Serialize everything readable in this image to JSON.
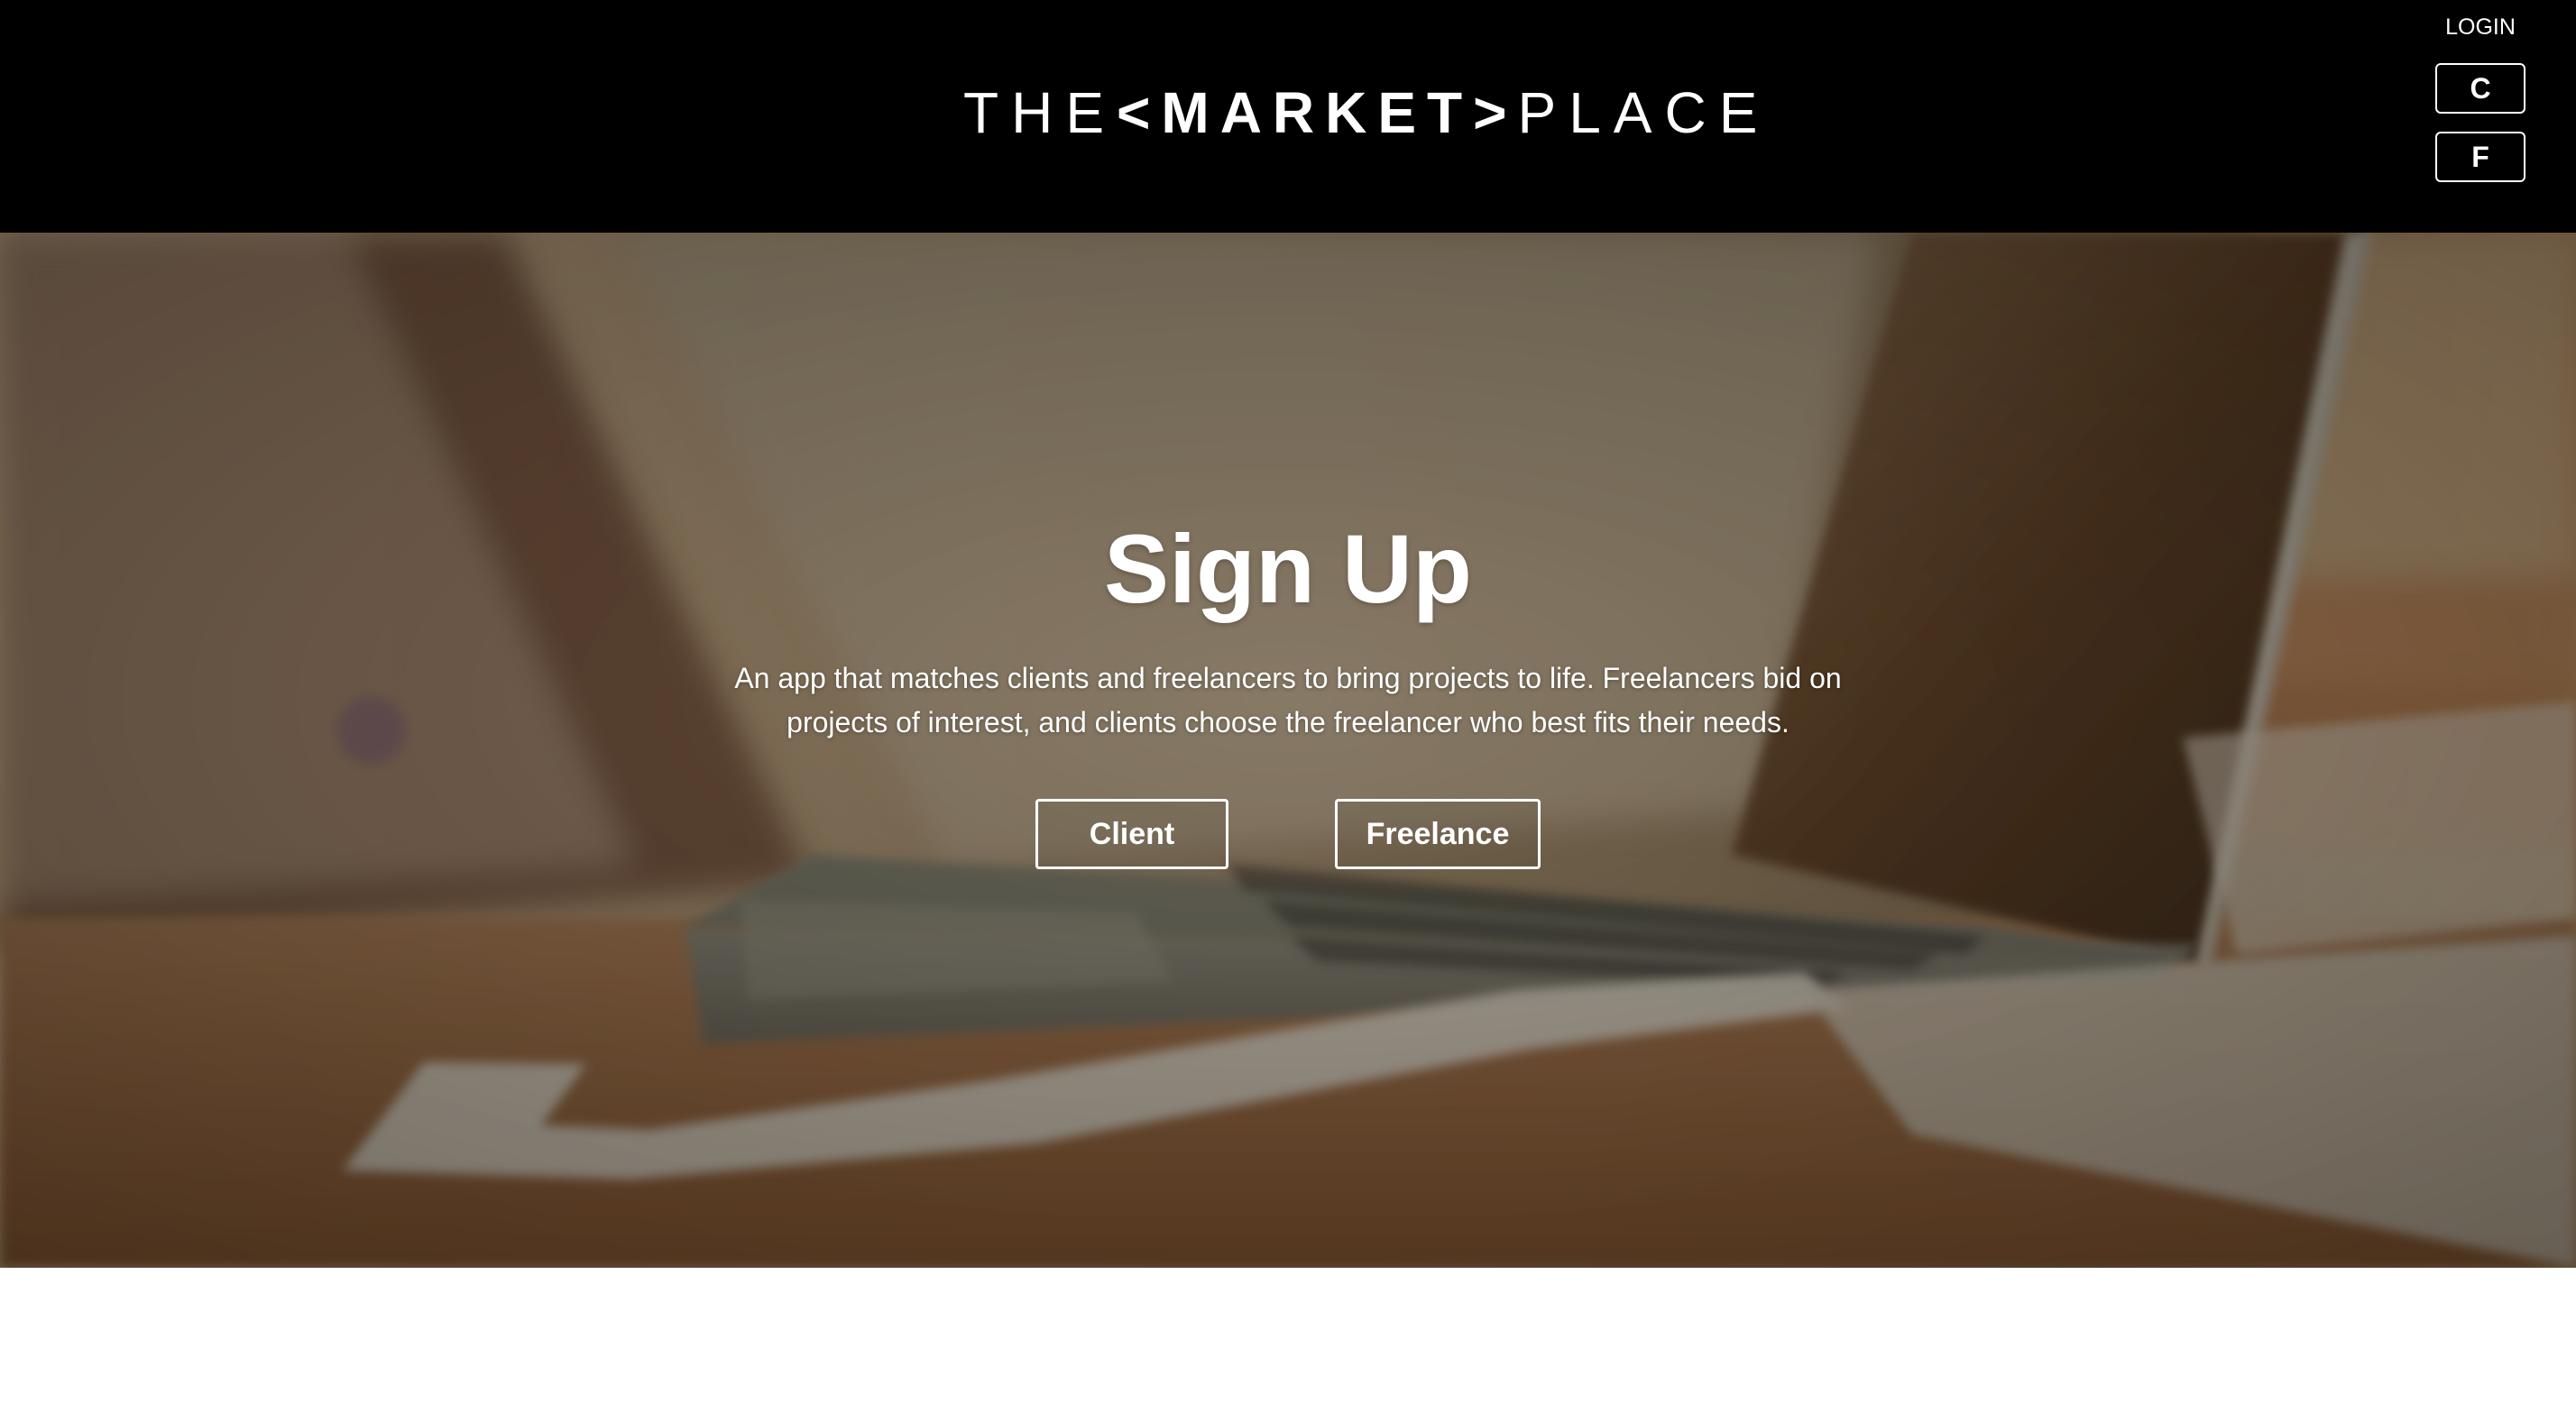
{
  "header": {
    "logo": {
      "prefix": "THE",
      "middle": "<MARKET>",
      "suffix": "PLACE"
    },
    "login_label": "LOGIN",
    "client_short": "C",
    "freelance_short": "F"
  },
  "hero": {
    "title": "Sign Up",
    "description": "An app that matches clients and freelancers to bring projects to life. Freelancers bid on projects of interest, and clients choose the freelancer who best fits their needs.",
    "client_button": "Client",
    "freelance_button": "Freelance",
    "background_description": "blurred laptop on wooden desk with papers"
  },
  "colors": {
    "header_bg": "#000000",
    "text": "#ffffff",
    "page_bg": "#ffffff"
  }
}
